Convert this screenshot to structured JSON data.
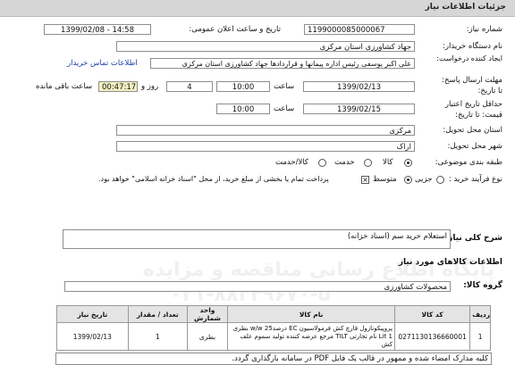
{
  "header": {
    "title": "جزئیات اطلاعات نیاز"
  },
  "fields": {
    "need_number_label": "شماره نیاز:",
    "need_number": "1199000085000067",
    "announce_label": "تاریخ و ساعت اعلان عمومی:",
    "announce_value": "1399/02/08 - 14:58",
    "buyer_org_label": "نام دستگاه خریدار:",
    "buyer_org": "جهاد کشاورزی استان مرکزی",
    "creator_label": "ایجاد کننده درخواست:",
    "creator": "علی اکبر یوسفی رئیس اداره پیمانها و قراردادها جهاد کشاورزی استان مرکزی",
    "contact_link": "اطلاعات تماس خریدار",
    "reply_label": "مهلت ارسال پاسخ:",
    "reply_label2": "تا تاریخ:",
    "reply_date": "1399/02/13",
    "time_label": "ساعت",
    "reply_time": "10:00",
    "day_label": "روز و",
    "days": "4",
    "remaining": "00:47:17",
    "remaining_label": "ساعت باقی مانده",
    "validity_label": "حداقل تاریخ اعتبار",
    "validity_label2": "قیمت: تا تاریخ:",
    "validity_date": "1399/02/15",
    "validity_time": "10:00",
    "province_label": "استان محل تحویل:",
    "province": "مرکزی",
    "city_label": "شهر محل تحویل:",
    "city": "اراک",
    "category_label": "طبقه بندی موضوعی:",
    "cat_goods": "کالا",
    "cat_service": "خدمت",
    "cat_goods_service": "کالا/خدمت",
    "process_label": "نوع فرآیند خرید :",
    "proc_small": "جزیی",
    "proc_medium": "متوسط",
    "treasury_note": "پرداخت تمام یا بخشی از مبلغ خرید، از محل \"اسناد خزانه اسلامی\" خواهد بود."
  },
  "summary": {
    "label": "شرح کلی نیاز:",
    "value": "استعلام خرید سم (اسناد خزانه)"
  },
  "goods_section": {
    "title": "اطلاعات کالاهای مورد نیاز"
  },
  "goods_group": {
    "label": "گروه کالا:",
    "value": "محصولات کشاورزی"
  },
  "table": {
    "headers": [
      "ردیف",
      "کد کالا",
      "نام کالا",
      "واحد شمارش",
      "تعداد / مقدار",
      "تاریخ نیاز"
    ],
    "rows": [
      {
        "row": "1",
        "code": "0271130136660001",
        "name": "پروپیکونازول قارچ کش فرمولاسیون EC درصد25 w/w بطری 1 Lit نام تجارتی TILT مرجع عرضه کننده تولید سموم علف کش",
        "unit": "بطری",
        "qty": "1",
        "date": "1399/02/13"
      }
    ]
  },
  "notes": {
    "text": "کلیه مدارک امضاء شده و ممهور در قالب یک فایل PDF  در سامانه بارگذاری گردد."
  },
  "watermark": {
    "line1": "پایگاه اطلاع رسانی مناقصه و مزایده",
    "line2": "۰۲۱-۸۸۳۴۹۶۷۰-۵"
  }
}
